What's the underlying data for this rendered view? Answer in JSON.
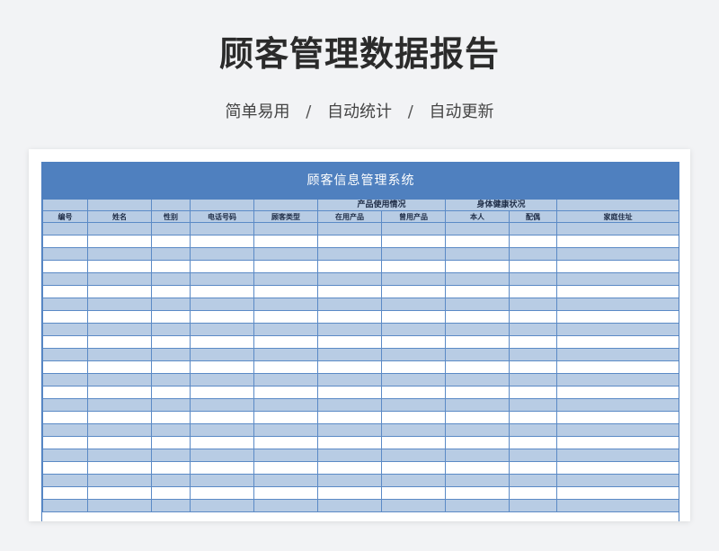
{
  "page": {
    "title": "顾客管理数据报告",
    "subtitle": [
      "简单易用",
      "自动统计",
      "自动更新"
    ],
    "subtitle_separator": "/"
  },
  "sheet": {
    "banner": "顾客信息管理系统",
    "group_headers": {
      "product_usage": "产品使用情况",
      "health_status": "身体健康状况"
    },
    "columns": [
      "编号",
      "姓名",
      "性别",
      "电话号码",
      "顾客类型",
      "在用产品",
      "曾用产品",
      "本人",
      "配偶",
      "家庭住址"
    ],
    "empty_row_count": 23
  },
  "colors": {
    "banner": "#4f80bf",
    "band": "#b8cce4",
    "grid": "#5b8ac6",
    "background": "#f2f3f5"
  }
}
